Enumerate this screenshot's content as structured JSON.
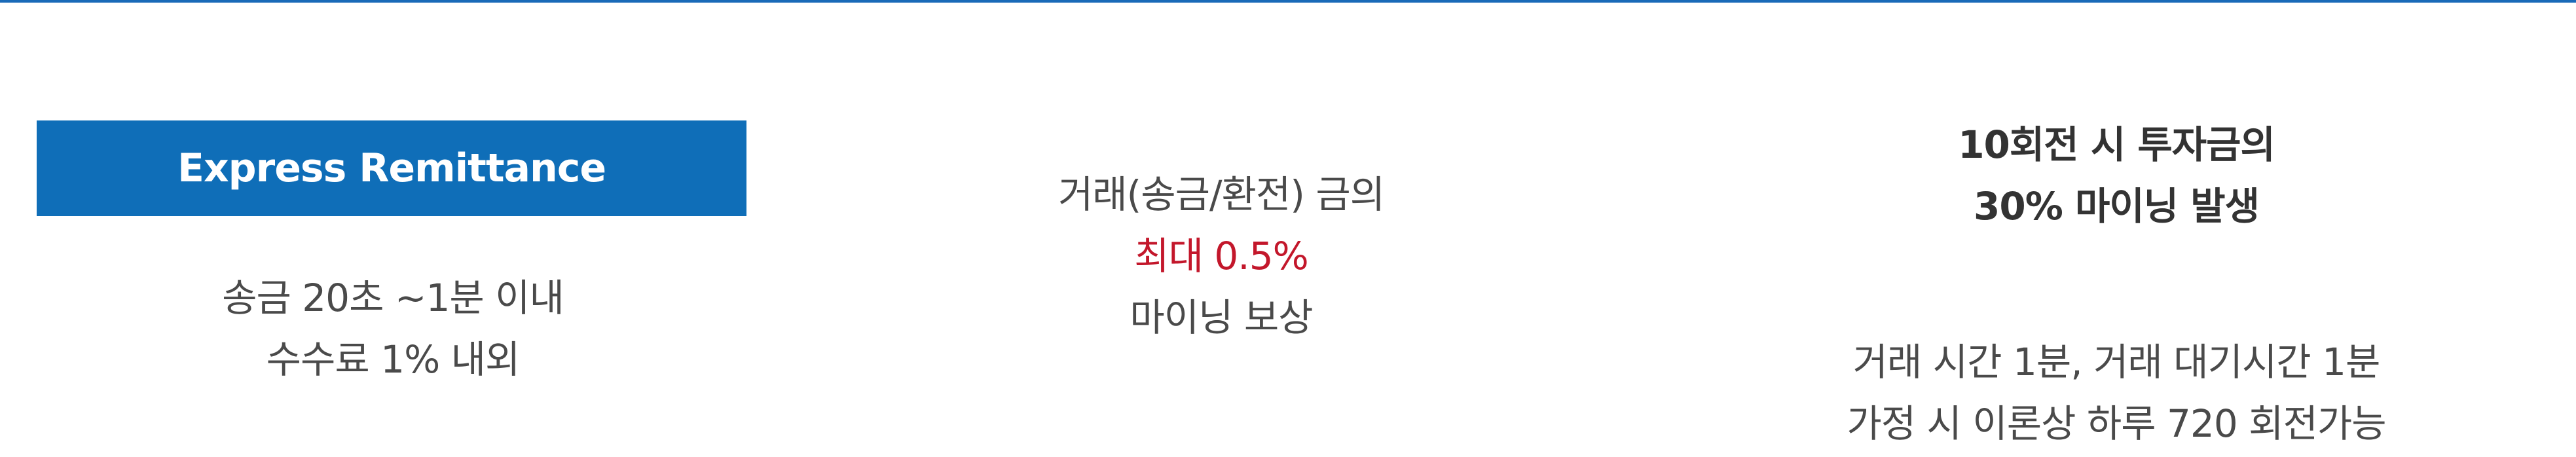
{
  "colors": {
    "accent_blue": "#0f6eb8",
    "highlight_red": "#c3172b",
    "body_text": "#4a4a4a"
  },
  "col1": {
    "badge": "Express Remittance",
    "line1": "송금 20초 ~1분 이내",
    "line2": "수수료 1% 내외"
  },
  "col2": {
    "line1": "거래(송금/환전) 금의",
    "line2": "최대 0.5%",
    "line3": "마이닝 보상"
  },
  "col3": {
    "head1": "10회전 시 투자금의",
    "head2": "30% 마이닝 발생",
    "body1": "거래 시간 1분, 거래 대기시간 1분",
    "body2": "가정 시 이론상 하루 720 회전가능"
  }
}
